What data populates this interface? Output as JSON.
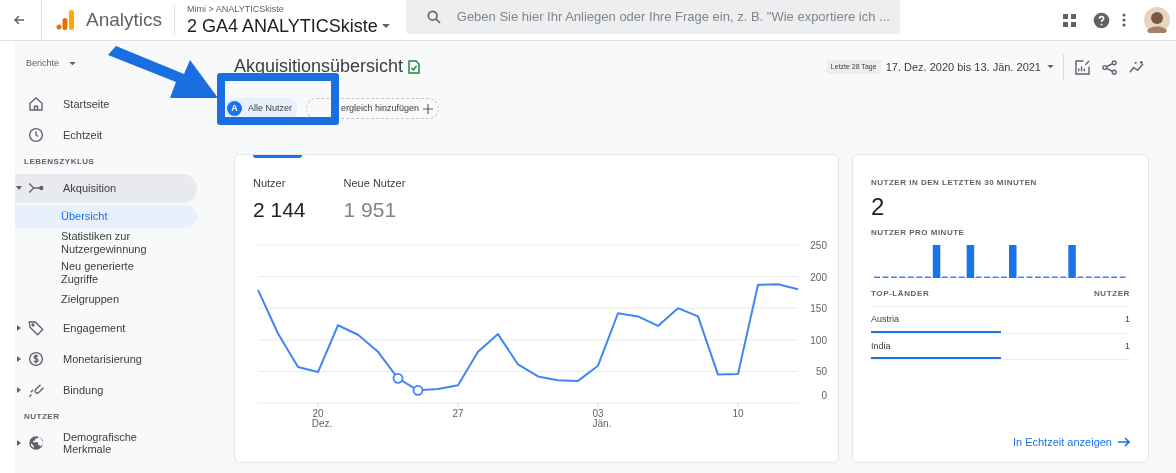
{
  "topbar": {
    "app_name": "Analytics",
    "breadcrumb": "Mimi > ANALYTICSkiste",
    "property": "2 GA4 ANALYTICSkiste",
    "search": {
      "placeholder": "Geben Sie hier Ihr Anliegen oder Ihre Frage ein, z. B. \"Wie exportiere ich ..."
    }
  },
  "sidebar": {
    "menu": "Berichte",
    "items": [
      {
        "kind": "item",
        "label": "Startseite"
      },
      {
        "kind": "item",
        "label": "Echtzeit"
      },
      {
        "kind": "section",
        "label": "LEBENSZYKLUS"
      },
      {
        "kind": "group",
        "label": "Akquisition",
        "expanded": true,
        "children": [
          {
            "label": "Übersicht",
            "selected": true
          },
          {
            "label": "Statistiken zur Nutzergewinnung",
            "selected": false
          },
          {
            "label": "Neu generierte Zugriffe",
            "selected": false
          },
          {
            "label": "Zielgruppen",
            "selected": false
          }
        ]
      },
      {
        "kind": "group",
        "label": "Engagement",
        "expanded": false
      },
      {
        "kind": "group",
        "label": "Monetarisierung",
        "expanded": false
      },
      {
        "kind": "group",
        "label": "Bindung",
        "expanded": false
      },
      {
        "kind": "section",
        "label": "NUTZER"
      },
      {
        "kind": "group",
        "label": "Demografische Merkmale",
        "expanded": false
      }
    ]
  },
  "page": {
    "title": "Akquisitionsübersicht",
    "chips": [
      {
        "kind": "segment",
        "badge": "A",
        "label": "Alle Nutzer"
      },
      {
        "kind": "add",
        "label": "ergleich hinzufügen"
      }
    ],
    "date_preset": "Letzte 28 Tage",
    "date_range": "17. Dez. 2020 bis 13. Jän. 2021"
  },
  "users_card": {
    "metrics": [
      {
        "label": "Nutzer",
        "value": "2 144",
        "selected": true
      },
      {
        "label": "Neue Nutzer",
        "value": "1 951",
        "selected": false
      }
    ],
    "chart_data": {
      "type": "line",
      "categories": [
        null,
        null,
        null,
        "20 Dez.",
        null,
        null,
        null,
        null,
        null,
        null,
        "27",
        null,
        null,
        null,
        null,
        null,
        null,
        "03 Jän.",
        null,
        null,
        null,
        null,
        null,
        null,
        "10",
        null,
        null,
        null
      ],
      "series": [
        {
          "color": "#4285f4",
          "values": [
            179,
            110,
            57,
            49,
            123,
            108,
            81,
            39,
            20,
            22,
            28,
            81,
            109,
            61,
            42,
            36,
            35,
            59,
            142,
            137,
            122,
            150,
            137,
            45,
            46,
            187,
            188,
            180
          ]
        }
      ],
      "ylim": [
        0,
        250
      ],
      "yticks": [
        0,
        50,
        100,
        150,
        200,
        250
      ],
      "grid": true
    }
  },
  "realtime_card": {
    "title": "NUTZER IN DEN LETZTEN 30 MINUTEN",
    "value": "2",
    "subtitle": "NUTZER PRO MINUTE",
    "columns": [
      "TOP-LÄNDER",
      "NUTZER"
    ],
    "rows": [
      {
        "country": "Austria",
        "users": "1",
        "level": 0.5
      },
      {
        "country": "India",
        "users": "1",
        "level": 0.5
      }
    ],
    "link": "In Echtzeit anzeigen"
  }
}
